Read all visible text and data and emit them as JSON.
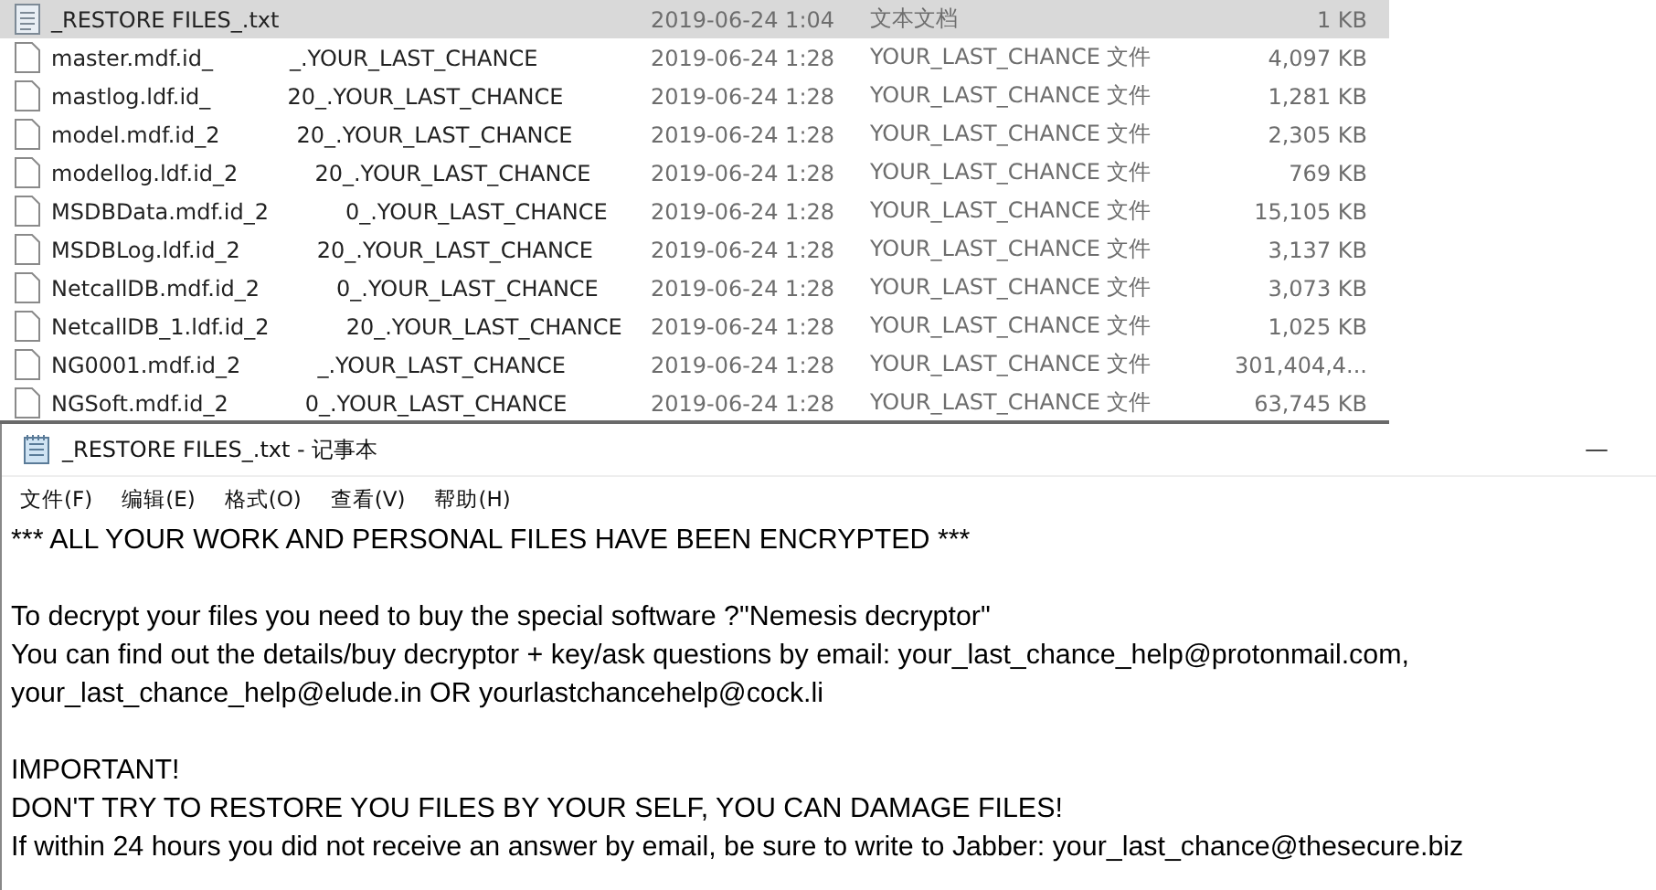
{
  "file_list": {
    "rows": [
      {
        "name_prefix": "_RESTORE FILES_.txt",
        "kind": "text",
        "date": "2019-06-24 1:04",
        "type": "文本文档",
        "size": "1 KB",
        "selected": true
      },
      {
        "name_prefix": "master.mdf.id_",
        "name_suffix": "_.YOUR_LAST_CHANCE",
        "kind": "file",
        "date": "2019-06-24 1:28",
        "type": "YOUR_LAST_CHANCE 文件",
        "size": "4,097 KB",
        "selected": false
      },
      {
        "name_prefix": "mastlog.ldf.id_",
        "name_suffix": "20_.YOUR_LAST_CHANCE",
        "kind": "file",
        "date": "2019-06-24 1:28",
        "type": "YOUR_LAST_CHANCE 文件",
        "size": "1,281 KB",
        "selected": false
      },
      {
        "name_prefix": "model.mdf.id_2",
        "name_suffix": "20_.YOUR_LAST_CHANCE",
        "kind": "file",
        "date": "2019-06-24 1:28",
        "type": "YOUR_LAST_CHANCE 文件",
        "size": "2,305 KB",
        "selected": false
      },
      {
        "name_prefix": "modellog.ldf.id_2",
        "name_suffix": "20_.YOUR_LAST_CHANCE",
        "kind": "file",
        "date": "2019-06-24 1:28",
        "type": "YOUR_LAST_CHANCE 文件",
        "size": "769 KB",
        "selected": false
      },
      {
        "name_prefix": "MSDBData.mdf.id_2",
        "name_suffix": "0_.YOUR_LAST_CHANCE",
        "kind": "file",
        "date": "2019-06-24 1:28",
        "type": "YOUR_LAST_CHANCE 文件",
        "size": "15,105 KB",
        "selected": false
      },
      {
        "name_prefix": "MSDBLog.ldf.id_2",
        "name_suffix": "20_.YOUR_LAST_CHANCE",
        "kind": "file",
        "date": "2019-06-24 1:28",
        "type": "YOUR_LAST_CHANCE 文件",
        "size": "3,137 KB",
        "selected": false
      },
      {
        "name_prefix": "NetcallDB.mdf.id_2",
        "name_suffix": "0_.YOUR_LAST_CHANCE",
        "kind": "file",
        "date": "2019-06-24 1:28",
        "type": "YOUR_LAST_CHANCE 文件",
        "size": "3,073 KB",
        "selected": false
      },
      {
        "name_prefix": "NetcallDB_1.ldf.id_2",
        "name_suffix": "20_.YOUR_LAST_CHANCE",
        "kind": "file",
        "date": "2019-06-24 1:28",
        "type": "YOUR_LAST_CHANCE 文件",
        "size": "1,025 KB",
        "selected": false
      },
      {
        "name_prefix": "NG0001.mdf.id_2",
        "name_suffix": "_.YOUR_LAST_CHANCE",
        "kind": "file",
        "date": "2019-06-24 1:28",
        "type": "YOUR_LAST_CHANCE 文件",
        "size": "301,404,4...",
        "selected": false
      },
      {
        "name_prefix": "NGSoft.mdf.id_2",
        "name_suffix": "0_.YOUR_LAST_CHANCE",
        "kind": "file",
        "date": "2019-06-24 1:28",
        "type": "YOUR_LAST_CHANCE 文件",
        "size": "63,745 KB",
        "selected": false
      }
    ]
  },
  "notepad": {
    "title": "_RESTORE FILES_.txt - 记事本",
    "minimize": "—",
    "menu": [
      "文件(F)",
      "编辑(E)",
      "格式(O)",
      "查看(V)",
      "帮助(H)"
    ],
    "paragraphs": [
      [
        "*** ALL YOUR WORK AND PERSONAL FILES HAVE BEEN ENCRYPTED ***"
      ],
      [
        "To decrypt your files you need to buy the special software ?\"Nemesis decryptor\"",
        "You can find out the details/buy decryptor + key/ask questions by email: your_last_chance_help@protonmail.com,",
        "your_last_chance_help@elude.in OR yourlastchancehelp@cock.li"
      ],
      [
        "IMPORTANT!",
        "DON'T TRY TO RESTORE YOU FILES BY YOUR SELF, YOU CAN DAMAGE FILES!",
        "If within 24 hours you did not receive an answer by email, be sure to write to Jabber: your_last_chance@thesecure.biz"
      ]
    ]
  }
}
